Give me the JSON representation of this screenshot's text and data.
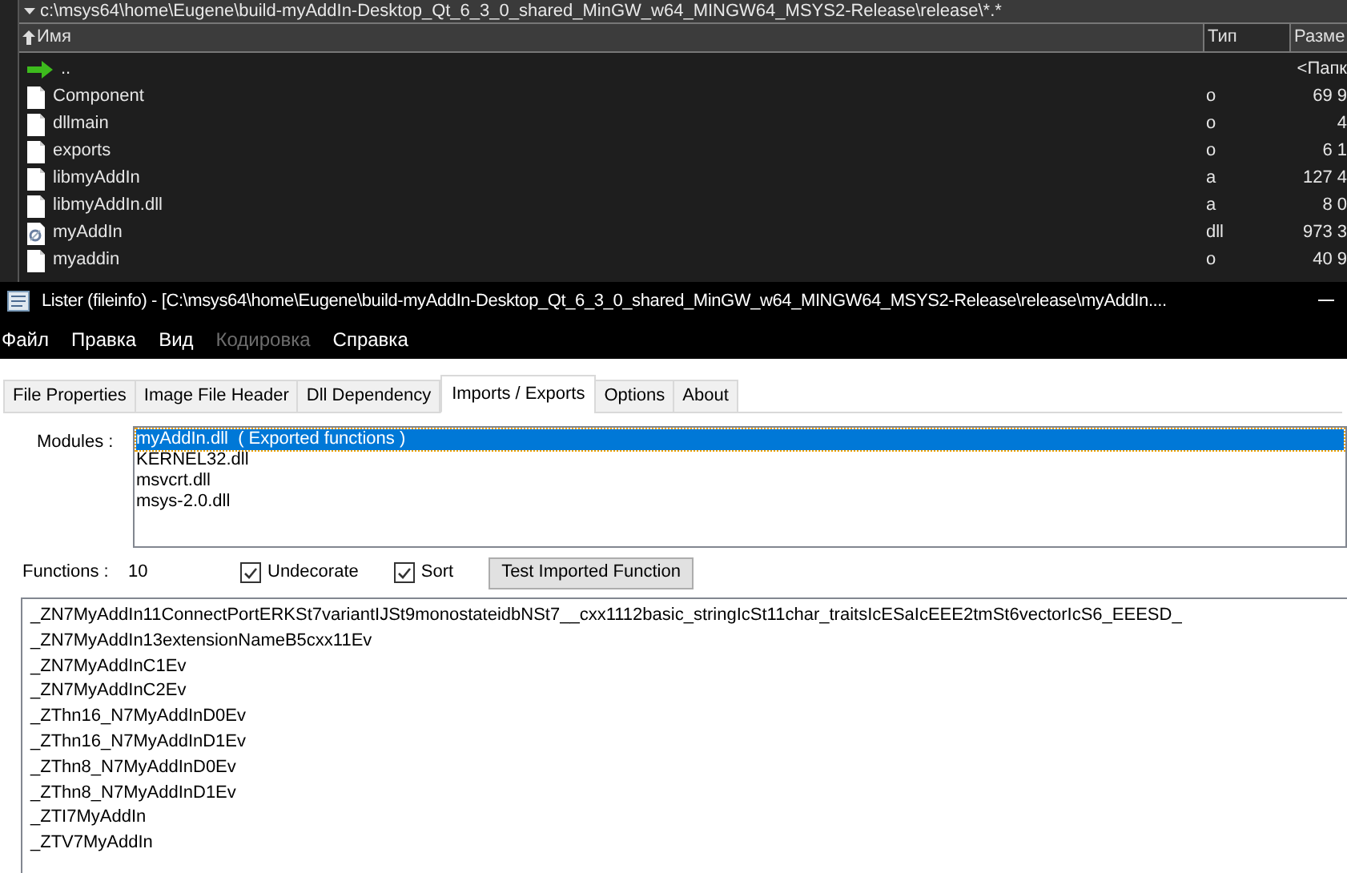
{
  "file_panel": {
    "path": "c:\\msys64\\home\\Eugene\\build-myAddIn-Desktop_Qt_6_3_0_shared_MinGW_w64_MINGW64_MSYS2-Release\\release\\*.*",
    "columns": [
      {
        "label": "Имя",
        "sorted": true
      },
      {
        "label": "Тип",
        "sorted": false
      },
      {
        "label": "Разме",
        "sorted": false
      }
    ],
    "rows": [
      {
        "kind": "up",
        "name": "..",
        "type": "",
        "size": "<Папк"
      },
      {
        "kind": "file",
        "name": "Component",
        "type": "o",
        "size": "69 9"
      },
      {
        "kind": "file",
        "name": "dllmain",
        "type": "o",
        "size": "4"
      },
      {
        "kind": "file",
        "name": "exports",
        "type": "o",
        "size": "6 1"
      },
      {
        "kind": "file",
        "name": "libmyAddIn",
        "type": "a",
        "size": "127 4"
      },
      {
        "kind": "file",
        "name": "libmyAddIn.dll",
        "type": "a",
        "size": "8 0"
      },
      {
        "kind": "dll",
        "name": "myAddIn",
        "type": "dll",
        "size": "973 3"
      },
      {
        "kind": "file",
        "name": "myaddin",
        "type": "o",
        "size": "40 9"
      }
    ]
  },
  "window": {
    "title": "Lister (fileinfo) - [C:\\msys64\\home\\Eugene\\build-myAddIn-Desktop_Qt_6_3_0_shared_MinGW_w64_MINGW64_MSYS2-Release\\release\\myAddIn...."
  },
  "menu": [
    {
      "label": "Файл",
      "disabled": false
    },
    {
      "label": "Правка",
      "disabled": false
    },
    {
      "label": "Вид",
      "disabled": false
    },
    {
      "label": "Кодировка",
      "disabled": true
    },
    {
      "label": "Справка",
      "disabled": false
    }
  ],
  "tabs": [
    {
      "label": "File Properties",
      "selected": false
    },
    {
      "label": "Image File Header",
      "selected": false
    },
    {
      "label": "Dll Dependency",
      "selected": false
    },
    {
      "label": "Imports / Exports",
      "selected": true
    },
    {
      "label": "Options",
      "selected": false
    },
    {
      "label": "About",
      "selected": false
    }
  ],
  "modules": {
    "label": "Modules :",
    "items": [
      {
        "label": "myAddIn.dll  ( Exported functions )",
        "selected": true
      },
      {
        "label": "KERNEL32.dll",
        "selected": false
      },
      {
        "label": "msvcrt.dll",
        "selected": false
      },
      {
        "label": "msys-2.0.dll",
        "selected": false
      }
    ]
  },
  "functions": {
    "label": "Functions :",
    "count": "10",
    "options": [
      {
        "label": "Undecorate",
        "checked": true
      },
      {
        "label": "Sort",
        "checked": true
      }
    ],
    "button": "Test Imported Function",
    "items": [
      "_ZN7MyAddIn11ConnectPortERKSt7variantIJSt9monostateidbNSt7__cxx1112basic_stringIcSt11char_traitsIcESaIcEEE2tmSt6vectorIcS6_EEESD_",
      "_ZN7MyAddIn13extensionNameB5cxx11Ev",
      "_ZN7MyAddInC1Ev",
      "_ZN7MyAddInC2Ev",
      "_ZThn16_N7MyAddInD0Ev",
      "_ZThn16_N7MyAddInD1Ev",
      "_ZThn8_N7MyAddInD0Ev",
      "_ZThn8_N7MyAddInD1Ev",
      "_ZTI7MyAddIn",
      "_ZTV7MyAddIn"
    ]
  }
}
